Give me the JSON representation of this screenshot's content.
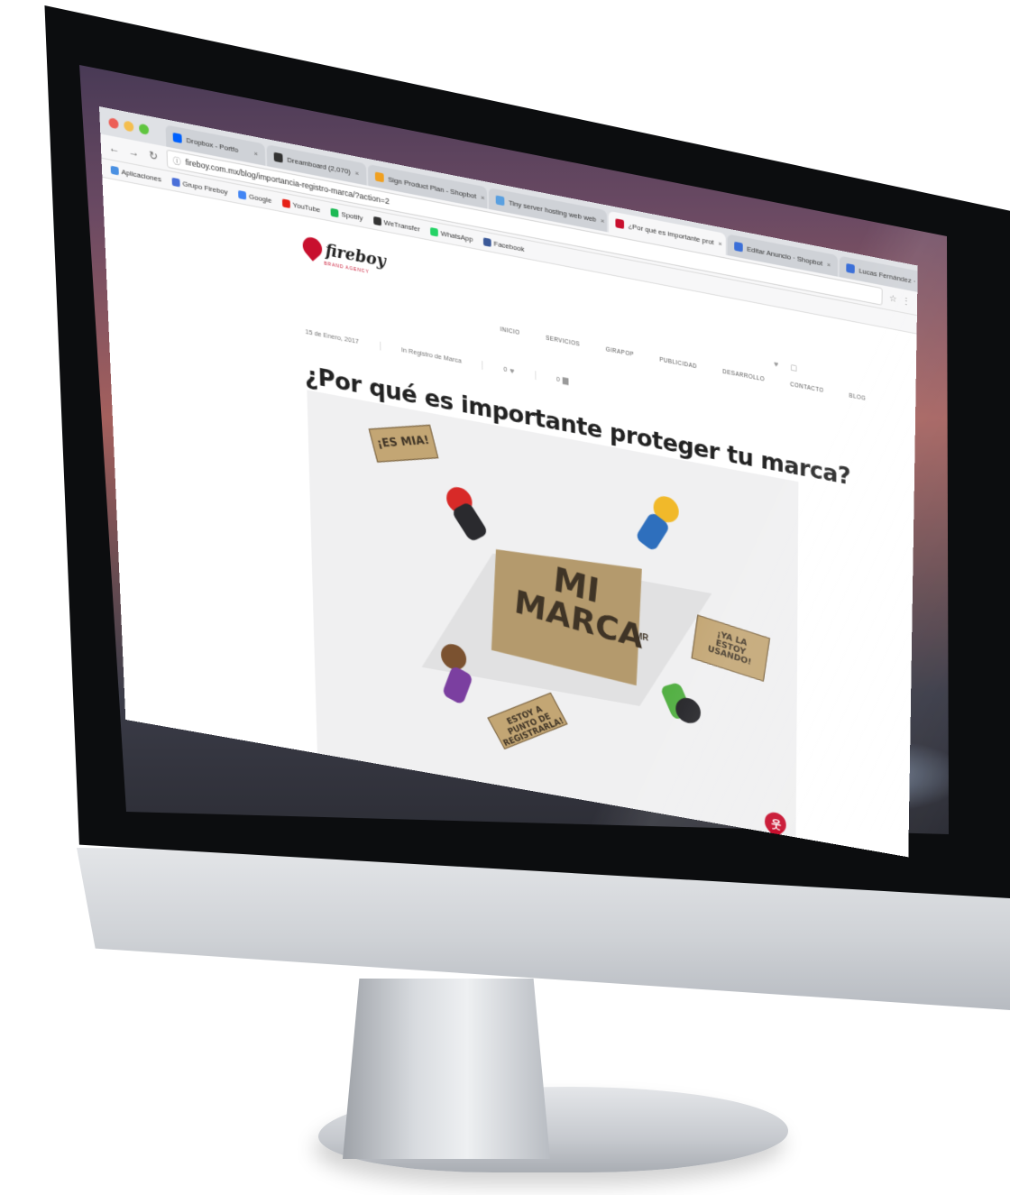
{
  "browser": {
    "tabs": [
      {
        "label": "Dropbox - Portfo",
        "color": "#0061fe",
        "active": false
      },
      {
        "label": "Dreamboard (2,070)",
        "color": "#333333",
        "active": false
      },
      {
        "label": "Sign Product Plan - Shopbot",
        "color": "#f0a020",
        "active": false
      },
      {
        "label": "Tiny server hosting web web",
        "color": "#5aa0e0",
        "active": false
      },
      {
        "label": "¿Por qué es importante prot",
        "color": "#c8102e",
        "active": true
      },
      {
        "label": "Editar Anuncio · Shopbot",
        "color": "#3b6fd8",
        "active": false
      },
      {
        "label": "Lucas Fernández · Shopbot",
        "color": "#3b6fd8",
        "active": false
      },
      {
        "label": "Personalización",
        "color": "#999999",
        "active": false
      }
    ],
    "url": "fireboy.com.mx/blog/importancia-registro-marca/?action=2",
    "bookmarks": [
      {
        "label": "Aplicaciones",
        "color": "#4a90e2"
      },
      {
        "label": "Grupo Fireboy",
        "color": "#4a6fd8"
      },
      {
        "label": "Google",
        "color": "#4285f4"
      },
      {
        "label": "YouTube",
        "color": "#e62117"
      },
      {
        "label": "Spotify",
        "color": "#1db954"
      },
      {
        "label": "WeTransfer",
        "color": "#333333"
      },
      {
        "label": "WhatsApp",
        "color": "#25d366"
      },
      {
        "label": "Facebook",
        "color": "#3b5998"
      }
    ]
  },
  "site": {
    "logo": "fireboy",
    "logo_tagline": "BRAND AGENCY",
    "top_icons": [
      "♥",
      "▢"
    ],
    "nav": [
      "INICIO",
      "SERVICIOS",
      "GIRAPOP",
      "PUBLICIDAD",
      "DESARROLLO",
      "CONTACTO",
      "BLOG"
    ],
    "post": {
      "date": "15 de Enero, 2017",
      "category": "In Registro de Marca",
      "likes": "0",
      "comments": "0",
      "title": "¿Por qué es importante proteger tu marca?"
    },
    "illustration": {
      "banner_line1": "MI",
      "banner_line2": "MARCA",
      "banner_mark": "MR",
      "sign_mia": "¡ES MIA!",
      "sign_usando_1": "¡YA LA",
      "sign_usando_2": "ESTOY USANDO!",
      "sign_punto": "ESTOY A PUNTO DE REGISTRARLA!"
    }
  },
  "colors": {
    "brand_red": "#c8102e",
    "banner_kraft": "#b49a6d"
  }
}
